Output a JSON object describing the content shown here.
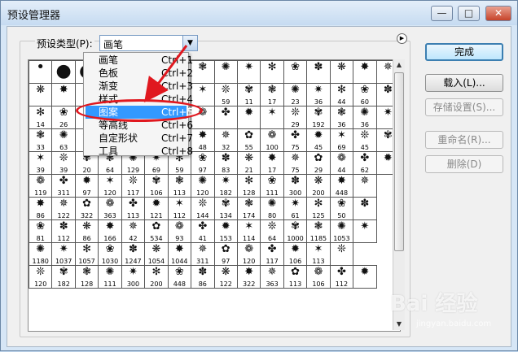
{
  "window": {
    "title": "预设管理器",
    "min_label": "—",
    "max_label": "□",
    "close_label": "✕"
  },
  "preset": {
    "label": "预设类型(P):",
    "value": "画笔",
    "arrow": "▼",
    "flyout": "▶"
  },
  "dropdown": {
    "items": [
      {
        "label": "画笔",
        "shortcut": "Ctrl+1"
      },
      {
        "label": "色板",
        "shortcut": "Ctrl+2"
      },
      {
        "label": "渐变",
        "shortcut": "Ctrl+3"
      },
      {
        "label": "样式",
        "shortcut": "Ctrl+4"
      },
      {
        "label": "图案",
        "shortcut": "Ctrl+5"
      },
      {
        "label": "等高线",
        "shortcut": "Ctrl+6"
      },
      {
        "label": "自定形状",
        "shortcut": "Ctrl+7"
      },
      {
        "label": "工具",
        "shortcut": "Ctrl+8"
      }
    ],
    "selected_index": 4
  },
  "buttons": {
    "done": "完成",
    "load": "载入(L)...",
    "save": "存储设置(S)...",
    "rename": "重命名(R)...",
    "delete": "删除(D)"
  },
  "scrollbar": {
    "up": "▲",
    "down": "▼"
  },
  "grid": {
    "rows": [
      [
        "",
        "",
        "",
        "",
        "",
        "",
        "",
        "",
        "",
        "",
        "",
        "",
        "",
        "",
        "",
        ""
      ],
      [
        "",
        "",
        "",
        "",
        "",
        "",
        "",
        "",
        "59",
        "11",
        "17",
        "23",
        "36",
        "44",
        "60",
        ""
      ],
      [
        "14",
        "26",
        "33",
        "",
        "",
        "",
        "",
        "",
        "",
        "",
        "",
        "29",
        "192",
        "36",
        "36",
        ""
      ],
      [
        "33",
        "63",
        "66",
        "",
        "",
        "",
        "",
        "48",
        "32",
        "55",
        "100",
        "75",
        "45",
        "69",
        "45",
        ""
      ],
      [
        "39",
        "39",
        "20",
        "64",
        "129",
        "69",
        "59",
        "97",
        "83",
        "21",
        "17",
        "75",
        "29",
        "44",
        "62",
        ""
      ],
      [
        "119",
        "311",
        "97",
        "120",
        "117",
        "106",
        "113",
        "120",
        "182",
        "128",
        "111",
        "300",
        "200",
        "448",
        ""
      ],
      [
        "86",
        "122",
        "322",
        "363",
        "113",
        "121",
        "112",
        "144",
        "134",
        "174",
        "80",
        "61",
        "125",
        "50",
        ""
      ],
      [
        "81",
        "112",
        "86",
        "166",
        "42",
        "534",
        "93",
        "41",
        "153",
        "114",
        "64",
        "1000",
        "1185",
        "1053",
        ""
      ],
      [
        "1180",
        "1037",
        "1057",
        "1030",
        "1247",
        "1054",
        "1044",
        "311",
        "97",
        "120",
        "117",
        "106",
        "113",
        ""
      ],
      [
        "120",
        "182",
        "128",
        "111",
        "300",
        "200",
        "448",
        "86",
        "122",
        "322",
        "363",
        "113",
        "106",
        "112",
        ""
      ]
    ]
  },
  "watermark": {
    "text": "Bai 经验",
    "sub": "jingyan.baidu.com"
  },
  "colors": {
    "highlight": "#e0181f",
    "selection": "#3399ff"
  }
}
